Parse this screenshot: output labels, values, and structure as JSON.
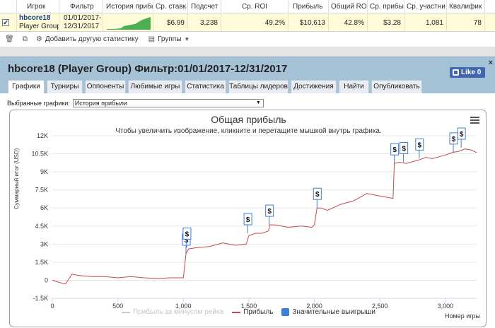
{
  "grid": {
    "columns": [
      "Игрок",
      "Фильтр",
      "История прибыл",
      "Ср. ставк",
      "Подсчет",
      "Ср. ROI",
      "Прибыль",
      "Общий ROI",
      "Ср. прибы",
      "Ср. участни",
      "Квалифик"
    ],
    "row": {
      "player": "hbcore18",
      "group": "Player Group",
      "filter_line1": "01/01/2017-",
      "filter_line2": "12/31/2017",
      "avg_stake": "$6.99",
      "count": "3,238",
      "avg_roi": "49.2%",
      "profit": "$10,613",
      "total_roi": "42.8%",
      "avg_profit": "$3.28",
      "avg_entrants": "1,081",
      "qualify": "78"
    },
    "checkbox_mark": "✔"
  },
  "toolbar": {
    "add_stats": "Добавить другую статистику",
    "groups": "Группы"
  },
  "dialog": {
    "title": "hbcore18 (Player Group) Фильтр:01/01/2017-12/31/2017",
    "close": "×",
    "like": "Like 0",
    "tabs": [
      "Графики",
      "Турниры",
      "Оппоненты",
      "Любимые игры",
      "Статистика",
      "Таблицы лидеров",
      "Достижения",
      "Найти",
      "Опубликовать"
    ],
    "active_tab": "Графики",
    "select_label": "Выбранные графики:",
    "select_value": "История прибыли"
  },
  "chart_data": {
    "type": "line",
    "title": "Общая прибыль",
    "subtitle": "Чтобы увеличить изображение, кликните и перетащите мышкой внутрь графика.",
    "ylabel": "Суммарный итог (USD)",
    "xlabel": "Номер игры",
    "xlim": [
      0,
      3238
    ],
    "ylim": [
      -1500,
      12000
    ],
    "x_ticks": [
      "0",
      "500",
      "1,000",
      "1,500",
      "2,000",
      "2,500",
      "3,000"
    ],
    "y_ticks": [
      "-1.5K",
      "0",
      "1.5K",
      "3K",
      "4.5K",
      "6K",
      "7.5K",
      "9K",
      "10.5K",
      "12K"
    ],
    "grid": true,
    "legend_position": "bottom",
    "series": [
      {
        "name": "Прибыль",
        "color": "#c9474b",
        "x": [
          0,
          60,
          100,
          120,
          150,
          200,
          300,
          400,
          500,
          600,
          700,
          800,
          900,
          1000,
          1020,
          1040,
          1100,
          1200,
          1300,
          1400,
          1480,
          1500,
          1550,
          1600,
          1650,
          1660,
          1700,
          1800,
          1900,
          1980,
          2000,
          2020,
          2050,
          2100,
          2200,
          2300,
          2400,
          2500,
          2600,
          2610,
          2650,
          2700,
          2800,
          2850,
          2900,
          3000,
          3050,
          3100,
          3150,
          3200,
          3238
        ],
        "y": [
          0,
          -200,
          -300,
          0,
          500,
          400,
          300,
          300,
          200,
          300,
          200,
          150,
          200,
          200,
          2200,
          2600,
          2700,
          2800,
          3100,
          2900,
          3000,
          3700,
          3900,
          3900,
          4100,
          4600,
          4600,
          4400,
          4500,
          4400,
          4600,
          6000,
          6000,
          5800,
          6300,
          6600,
          7200,
          7000,
          6800,
          9700,
          9800,
          9700,
          10000,
          10200,
          10100,
          10400,
          10600,
          10700,
          10900,
          10800,
          10600
        ]
      },
      {
        "name": "Прибыль за минусом рейка",
        "color": "#cccccc",
        "hidden": true,
        "x": [],
        "y": []
      }
    ],
    "markers": {
      "name": "Значительные выигрыши",
      "color": "#3d7fd6",
      "symbol": "$",
      "points": [
        {
          "x": 1020,
          "y": 2200
        },
        {
          "x": 1025,
          "y": 2700
        },
        {
          "x": 1490,
          "y": 3900
        },
        {
          "x": 1655,
          "y": 4600
        },
        {
          "x": 2020,
          "y": 6000
        },
        {
          "x": 2610,
          "y": 9700
        },
        {
          "x": 2680,
          "y": 9800
        },
        {
          "x": 2800,
          "y": 10100
        },
        {
          "x": 3060,
          "y": 10600
        },
        {
          "x": 3120,
          "y": 11000
        }
      ]
    }
  }
}
